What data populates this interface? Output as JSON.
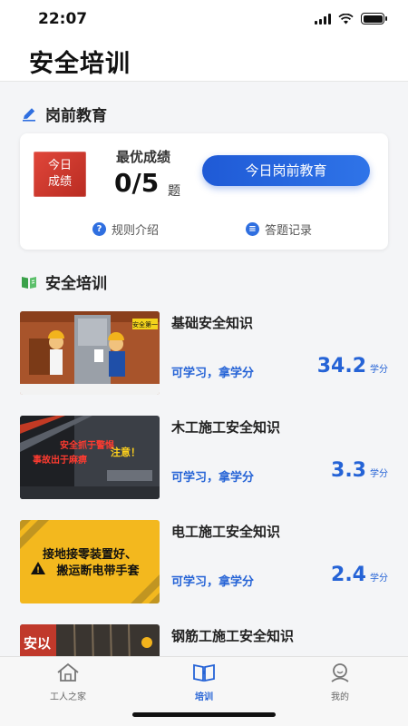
{
  "status": {
    "time": "22:07"
  },
  "header": {
    "title": "安全培训"
  },
  "pre_job": {
    "section_label": "岗前教育",
    "badge_line1": "今日",
    "badge_line2": "成绩",
    "best_label": "最优成绩",
    "score": "0/5",
    "score_unit": "题",
    "button_label": "今日岗前教育",
    "rules_link": "规则介绍",
    "records_link": "答题记录"
  },
  "training": {
    "section_label": "安全培训",
    "courses": [
      {
        "title": "基础安全知识",
        "subtitle": "可学习，拿学分",
        "credit": "34.2",
        "credit_unit": "学分",
        "thumb_text": "安全第一"
      },
      {
        "title": "木工施工安全知识",
        "subtitle": "可学习，拿学分",
        "credit": "3.3",
        "credit_unit": "学分",
        "thumb_text_1": "安全抓于警惕",
        "thumb_text_2": "事故出于麻痹",
        "thumb_text_3": "注意！"
      },
      {
        "title": "电工施工安全知识",
        "subtitle": "可学习，拿学分",
        "credit": "2.4",
        "credit_unit": "学分",
        "thumb_text_1": "接地接零装置好、",
        "thumb_text_2": "搬运断电带手套"
      },
      {
        "title": "钢筋工施工安全知识",
        "thumb_text": "安以"
      }
    ]
  },
  "tabs": [
    {
      "label": "工人之家",
      "icon": "home-icon"
    },
    {
      "label": "培训",
      "icon": "book-icon"
    },
    {
      "label": "我的",
      "icon": "profile-icon"
    }
  ],
  "colors": {
    "accent": "#2563d6",
    "badge": "#d23a2f"
  }
}
